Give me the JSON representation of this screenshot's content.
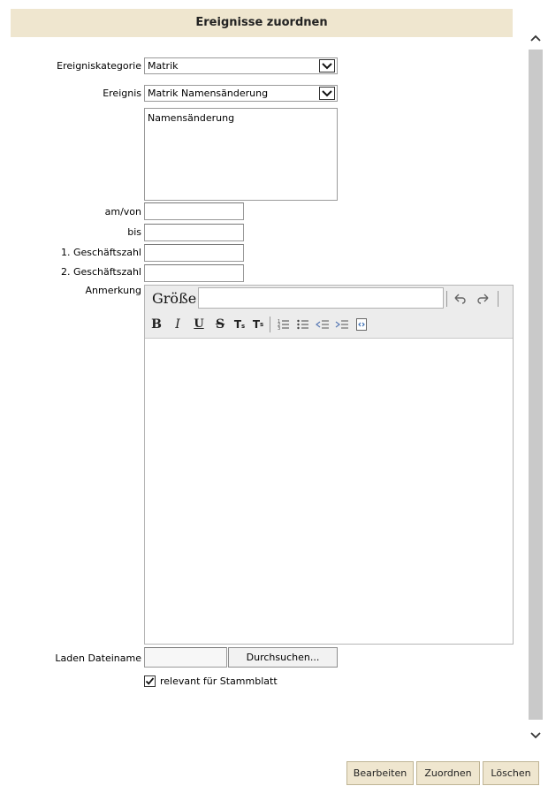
{
  "dialog": {
    "title": "Ereignisse zuordnen"
  },
  "form": {
    "category_label": "Ereigniskategorie",
    "category_value": "Matrik",
    "event_label": "Ereignis",
    "event_value": "Matrik Namensänderung",
    "event_description": "Namensänderung",
    "date_from_label": "am/von",
    "date_from_value": "",
    "date_to_label": "bis",
    "date_to_value": "",
    "case_number_1_label": "1. Geschäftszahl",
    "case_number_1_value": "",
    "case_number_2_label": "2. Geschäftszahl",
    "case_number_2_value": "",
    "note_label": "Anmerkung",
    "file_label": "Laden Dateiname",
    "file_value": "",
    "browse_label": "Durchsuchen...",
    "relevant_label": "relevant für Stammblatt",
    "relevant_checked": true
  },
  "editor": {
    "size_label": "Größe",
    "size_value": "",
    "icons": [
      "undo-icon",
      "redo-icon",
      "bold-icon",
      "italic-icon",
      "underline-icon",
      "strikethrough-icon",
      "subscript-icon",
      "superscript-icon",
      "ordered-list-icon",
      "unordered-list-icon",
      "outdent-icon",
      "indent-icon",
      "source-icon"
    ]
  },
  "footer": {
    "edit_label": "Bearbeiten",
    "assign_label": "Zuordnen",
    "delete_label": "Löschen"
  },
  "colors": {
    "header_bg": "#efe6cf",
    "scrollbar": "#c9c9c9"
  }
}
